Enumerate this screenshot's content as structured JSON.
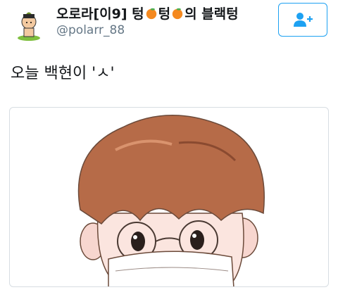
{
  "tweet": {
    "display_name_prefix": "오로라[이9] 텅",
    "display_name_mid": "텅",
    "display_name_suffix": "의 블랙텅",
    "handle": "@polarr_88",
    "text": "오늘 백현이 'ㅅ'"
  },
  "icons": {
    "follow": "add-user-icon",
    "emoji": "tangerine-emoji"
  },
  "colors": {
    "accent": "#1da1f2",
    "handle": "#657786",
    "border": "#d7dde2"
  }
}
